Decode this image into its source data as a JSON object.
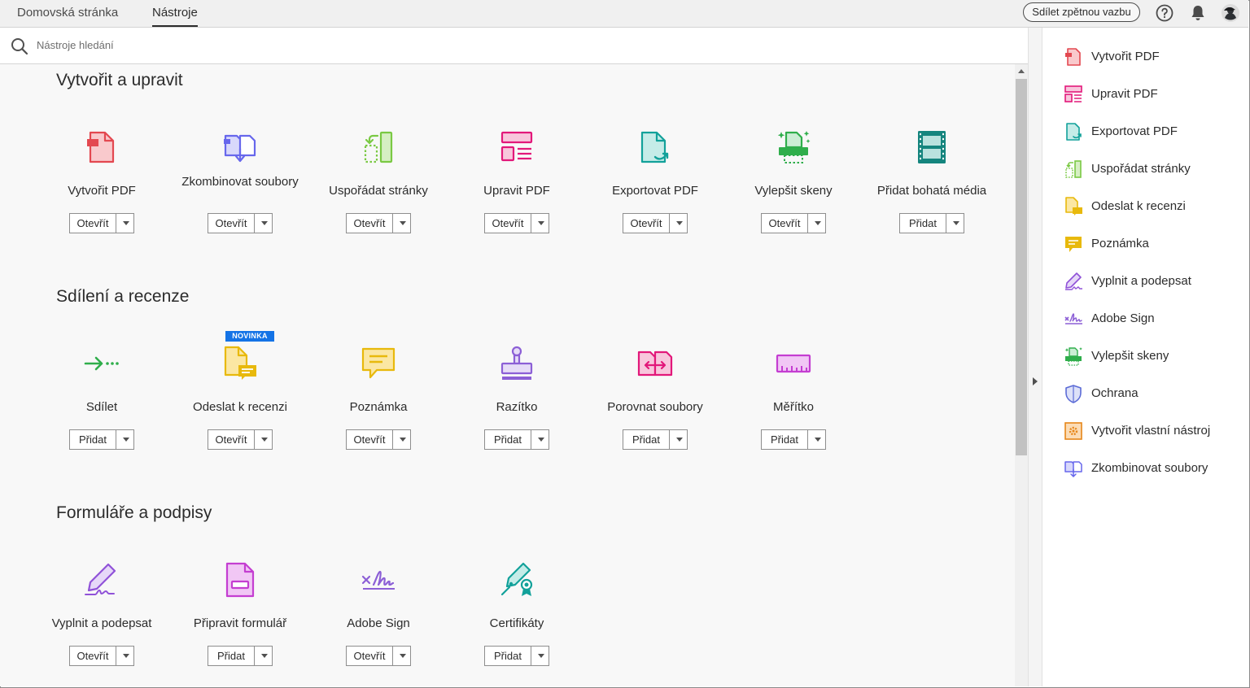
{
  "tabs": [
    {
      "label": "Domovská stránka",
      "active": false
    },
    {
      "label": "Nástroje",
      "active": true
    }
  ],
  "header": {
    "feedback_label": "Sdílet zpětnou vazbu",
    "icons": [
      "help-icon",
      "bell-icon",
      "avatar"
    ]
  },
  "search": {
    "placeholder": "Nástroje hledání",
    "icon": "search-icon"
  },
  "sections": [
    {
      "title": "Vytvořit a upravit",
      "tools": [
        {
          "label": "Vytvořit PDF",
          "button": "Otevřít",
          "icon": "create-pdf-icon",
          "color": "#e34850"
        },
        {
          "label": "Zkombinovat soubory",
          "button": "Otevřít",
          "icon": "combine-files-icon",
          "color": "#6767ec"
        },
        {
          "label": "Uspořádat stránky",
          "button": "Otevřít",
          "icon": "organize-pages-icon",
          "color": "#7ac943"
        },
        {
          "label": "Upravit PDF",
          "button": "Otevřít",
          "icon": "edit-pdf-icon",
          "color": "#e2187a"
        },
        {
          "label": "Exportovat PDF",
          "button": "Otevřít",
          "icon": "export-pdf-icon",
          "color": "#12a19a"
        },
        {
          "label": "Vylepšit skeny",
          "button": "Otevřít",
          "icon": "enhance-scans-icon",
          "color": "#2fae4b"
        },
        {
          "label": "Přidat bohatá média",
          "button": "Přidat",
          "icon": "rich-media-icon",
          "color": "#15857e"
        }
      ]
    },
    {
      "title": "Sdílení a recenze",
      "tools": [
        {
          "label": "Sdílet",
          "button": "Přidat",
          "icon": "share-icon",
          "color": "#2fae4b"
        },
        {
          "label": "Odeslat k recenzi",
          "button": "Otevřít",
          "icon": "send-review-icon",
          "color": "#e8b90c",
          "badge": "NOVINKA"
        },
        {
          "label": "Poznámka",
          "button": "Otevřít",
          "icon": "comment-icon",
          "color": "#e8b90c"
        },
        {
          "label": "Razítko",
          "button": "Přidat",
          "icon": "stamp-icon",
          "color": "#8c5fd6"
        },
        {
          "label": "Porovnat soubory",
          "button": "Přidat",
          "icon": "compare-files-icon",
          "color": "#e2187a"
        },
        {
          "label": "Měřítko",
          "button": "Přidat",
          "icon": "measure-icon",
          "color": "#c43ed1"
        }
      ]
    },
    {
      "title": "Formuláře a podpisy",
      "tools": [
        {
          "label": "Vyplnit a podepsat",
          "button": "Otevřít",
          "icon": "fill-sign-icon",
          "color": "#9052d8"
        },
        {
          "label": "Připravit formulář",
          "button": "Přidat",
          "icon": "prepare-form-icon",
          "color": "#c43ed1"
        },
        {
          "label": "Adobe Sign",
          "button": "Otevřít",
          "icon": "adobe-sign-icon",
          "color": "#8c5fd6"
        },
        {
          "label": "Certifikáty",
          "button": "Přidat",
          "icon": "certificates-icon",
          "color": "#12a19a"
        }
      ]
    }
  ],
  "right_pane": [
    {
      "label": "Vytvořit PDF",
      "icon": "create-pdf-icon",
      "color": "#e34850"
    },
    {
      "label": "Upravit PDF",
      "icon": "edit-pdf-icon",
      "color": "#e2187a"
    },
    {
      "label": "Exportovat PDF",
      "icon": "export-pdf-icon",
      "color": "#12a19a"
    },
    {
      "label": "Uspořádat stránky",
      "icon": "organize-pages-icon",
      "color": "#7ac943"
    },
    {
      "label": "Odeslat k recenzi",
      "icon": "send-review-icon",
      "color": "#e8b90c"
    },
    {
      "label": "Poznámka",
      "icon": "comment-icon",
      "color": "#e8b90c"
    },
    {
      "label": "Vyplnit a podepsat",
      "icon": "fill-sign-icon",
      "color": "#9052d8"
    },
    {
      "label": "Adobe Sign",
      "icon": "adobe-sign-icon",
      "color": "#8c5fd6"
    },
    {
      "label": "Vylepšit skeny",
      "icon": "enhance-scans-icon",
      "color": "#2fae4b"
    },
    {
      "label": "Ochrana",
      "icon": "protect-icon",
      "color": "#5b6bd6"
    },
    {
      "label": "Vytvořit vlastní nástroj",
      "icon": "custom-tool-icon",
      "color": "#e68619"
    },
    {
      "label": "Zkombinovat soubory",
      "icon": "combine-files-icon",
      "color": "#6767ec"
    }
  ]
}
